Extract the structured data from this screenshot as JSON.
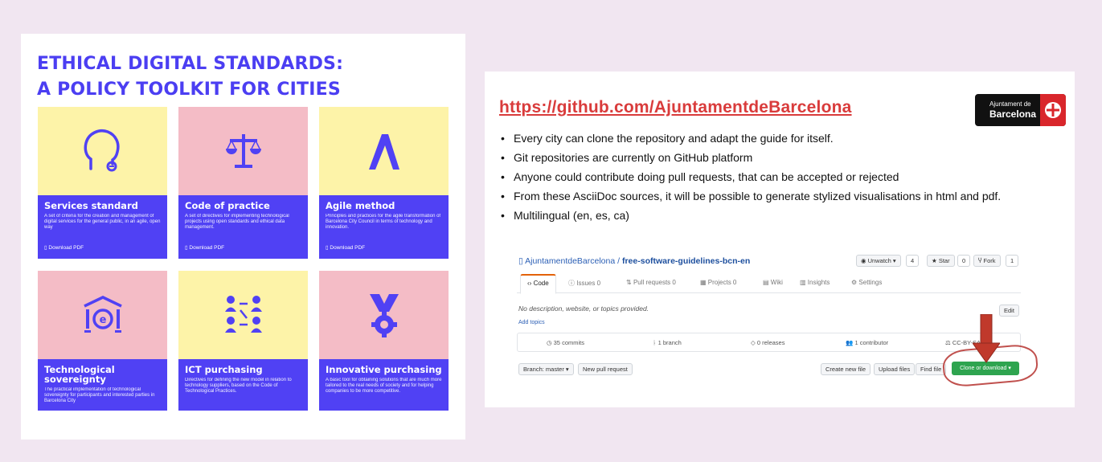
{
  "left": {
    "title_line1": "ETHICAL DIGITAL STANDARDS:",
    "title_line2": "A POLICY TOOLKIT FOR CITIES",
    "cards": [
      {
        "name": "Services standard",
        "desc": "A set of criteria for the creation and management of digital services for the general public, in an agile, open way",
        "download": "Download PDF",
        "bg": "yellow",
        "icon": "head-icon"
      },
      {
        "name": "Code of practice",
        "desc": "A set of directives for implementing technological projects using open standards and ethical data management.",
        "download": "Download PDF",
        "bg": "pink",
        "icon": "scales-icon"
      },
      {
        "name": "Agile method",
        "desc": "Principles and practices for the agile transformation of Barcelona City Council in terms of technology and innovation.",
        "download": "Download PDF",
        "bg": "yellow",
        "icon": "lambda-a-icon"
      },
      {
        "name": "Technological sovereignty",
        "desc": "The practical implementation of technological sovereignty for participants and interested parties in Barcelona City",
        "download": "",
        "bg": "pink",
        "icon": "institution-icon"
      },
      {
        "name": "ICT purchasing",
        "desc": "Directives for defining the new model in relation to technology suppliers, based on the Code of Technological Practices.",
        "download": "",
        "bg": "yellow",
        "icon": "people-network-icon"
      },
      {
        "name": "Innovative purchasing",
        "desc": "A basic tool for obtaining solutions that are much more tailored to the real needs of society and for helping companies to be more competitive.",
        "download": "",
        "bg": "pink",
        "icon": "medal-gear-icon"
      }
    ],
    "colors": {
      "accent": "#5041f4",
      "yellow": "#fdf3a8",
      "pink": "#f4bcc6"
    }
  },
  "right": {
    "link": "https://github.com/AjuntamentdeBarcelona",
    "logo": {
      "line1": "Ajuntament de",
      "line2": "Barcelona"
    },
    "bullets": [
      "Every city can clone the repository and adapt the guide for itself.",
      "Git repositories are currently on GitHub platform",
      "Anyone could contribute doing pull requests, that can be accepted or rejected",
      "From these AsciiDoc sources, it will be possible to generate stylized visualisations in html and pdf.",
      "Multilingual (en, es, ca)"
    ],
    "github": {
      "owner": "AjuntamentdeBarcelona",
      "separator": " / ",
      "repo": "free-software-guidelines-bcn-en",
      "unwatch": "Unwatch ▾",
      "unwatch_count": "4",
      "star": "Star",
      "star_count": "0",
      "fork": "Fork",
      "fork_count": "1",
      "tabs": [
        "Code",
        "Issues 0",
        "Pull requests 0",
        "Projects 0",
        "Wiki",
        "Insights",
        "Settings"
      ],
      "no_description": "No description, website, or topics provided.",
      "edit": "Edit",
      "add_topics": "Add topics",
      "stats": [
        "35 commits",
        "1 branch",
        "0 releases",
        "1 contributor",
        "CC-BY-SA"
      ],
      "branch": "Branch: master ▾",
      "new_pr": "New pull request",
      "create_file": "Create new file",
      "upload": "Upload files",
      "find": "Find file",
      "clone": "Clone or download ▾"
    }
  }
}
